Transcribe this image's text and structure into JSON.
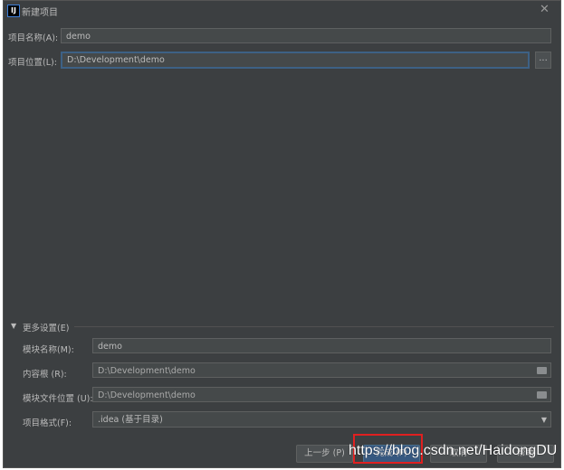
{
  "window": {
    "title": "新建项目",
    "close": "✕",
    "logo": "IJ"
  },
  "fields": {
    "project_name": {
      "label": "项目名称(A):",
      "value": "demo"
    },
    "project_location": {
      "label": "项目位置(L):",
      "value": "D:\\Development\\demo",
      "browse": "..."
    }
  },
  "more_settings": {
    "header": "更多设置(E)",
    "module_name": {
      "label": "模块名称(M):",
      "value": "demo"
    },
    "content_root": {
      "label": "内容根 (R):",
      "value": "D:\\Development\\demo"
    },
    "module_file_location": {
      "label": "模块文件位置 (U):",
      "value": "D:\\Development\\demo"
    },
    "project_format": {
      "label": "项目格式(F):",
      "value": ".idea (基于目录)"
    }
  },
  "buttons": {
    "previous": "上一步 (P)",
    "finish": "完成 (F)",
    "cancel": "取消",
    "help": "帮助"
  },
  "watermark": "https://blog.csdn.net/HaidongDU"
}
